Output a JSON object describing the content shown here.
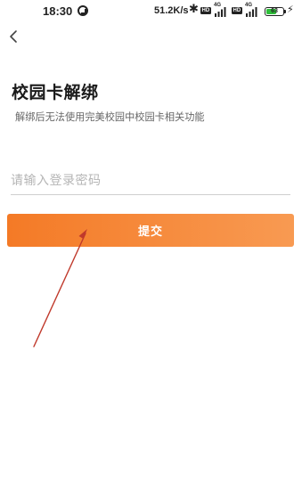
{
  "status_bar": {
    "time": "18:30",
    "network_speed": "51.2K/s",
    "bluetooth_icon": "bluetooth-icon",
    "hd_label": "HD",
    "network_type": "4G",
    "battery_level": "63",
    "battery_fraction": 0.63,
    "charging_icon": "bolt-icon"
  },
  "nav": {
    "back_icon": "chevron-left-icon"
  },
  "page": {
    "title": "校园卡解绑",
    "subtitle": "解绑后无法使用完美校园中校园卡相关功能"
  },
  "form": {
    "password_placeholder": "请输入登录密码",
    "password_value": "",
    "submit_label": "提交"
  },
  "colors": {
    "accent_start": "#f47a26",
    "accent_end": "#f89a52",
    "annotation_arrow": "#c0392b"
  }
}
